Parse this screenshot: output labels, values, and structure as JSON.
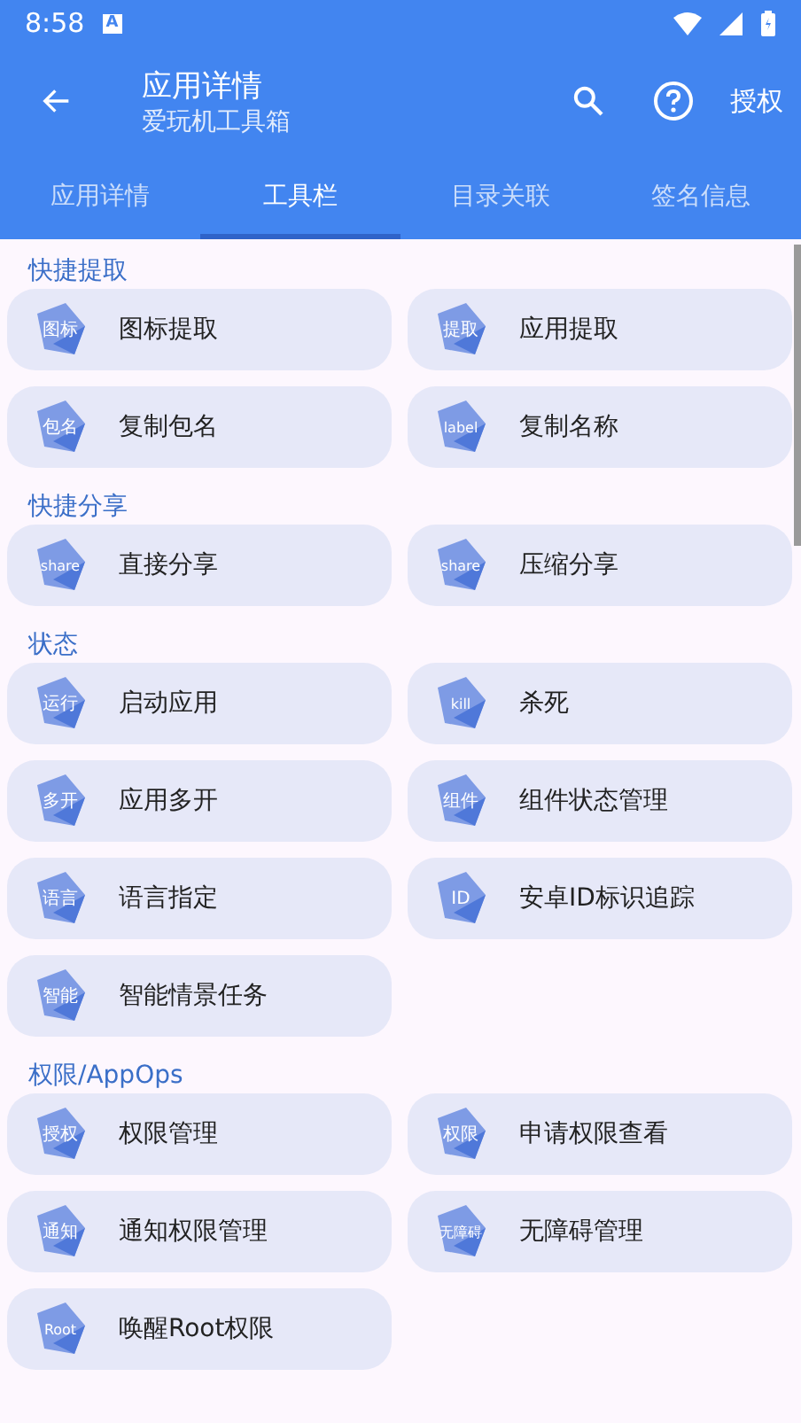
{
  "status_bar": {
    "time": "8:58",
    "notification": "A"
  },
  "app_bar": {
    "title": "应用详情",
    "subtitle": "爱玩机工具箱",
    "action": "授权"
  },
  "tabs": [
    {
      "label": "应用详情",
      "selected": false
    },
    {
      "label": "工具栏",
      "selected": true
    },
    {
      "label": "目录关联",
      "selected": false
    },
    {
      "label": "签名信息",
      "selected": false
    }
  ],
  "sections": [
    {
      "title": "快捷提取",
      "items": [
        {
          "badge": "图标",
          "label": "图标提取"
        },
        {
          "badge": "提取",
          "label": "应用提取"
        },
        {
          "badge": "包名",
          "label": "复制包名"
        },
        {
          "badge": "label",
          "label": "复制名称"
        }
      ]
    },
    {
      "title": "快捷分享",
      "items": [
        {
          "badge": "share",
          "label": "直接分享"
        },
        {
          "badge": "share",
          "label": "压缩分享"
        }
      ]
    },
    {
      "title": "状态",
      "items": [
        {
          "badge": "运行",
          "label": "启动应用"
        },
        {
          "badge": "kill",
          "label": "杀死"
        },
        {
          "badge": "多开",
          "label": "应用多开"
        },
        {
          "badge": "组件",
          "label": "组件状态管理"
        },
        {
          "badge": "语言",
          "label": "语言指定"
        },
        {
          "badge": "ID",
          "label": "安卓ID标识追踪"
        },
        {
          "badge": "智能",
          "label": "智能情景任务"
        }
      ]
    },
    {
      "title": "权限/AppOps",
      "items": [
        {
          "badge": "授权",
          "label": "权限管理"
        },
        {
          "badge": "权限",
          "label": "申请权限查看"
        },
        {
          "badge": "通知",
          "label": "通知权限管理"
        },
        {
          "badge": "无障碍",
          "label": "无障碍管理"
        },
        {
          "badge": "Root",
          "label": "唤醒Root权限"
        }
      ]
    }
  ]
}
